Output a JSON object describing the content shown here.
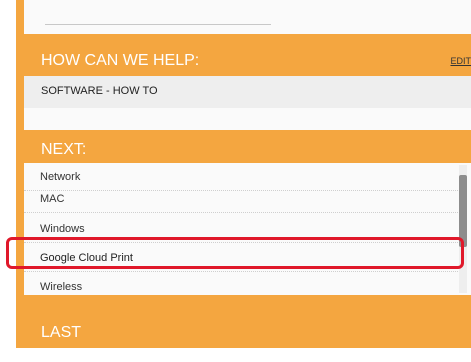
{
  "help_section": {
    "header": "HOW CAN WE HELP:",
    "edit_label": "EDIT",
    "value": "SOFTWARE - HOW TO"
  },
  "next_section": {
    "header": "NEXT:",
    "items": [
      {
        "label": "Network"
      },
      {
        "label": "MAC"
      },
      {
        "label": "Windows"
      },
      {
        "label": "Google Cloud Print"
      },
      {
        "label": "Wireless"
      }
    ],
    "selected_item": "Google Cloud Print"
  },
  "last_section": {
    "header": "LAST"
  },
  "colors": {
    "accent": "#f4a640",
    "highlight": "#e0182a"
  }
}
